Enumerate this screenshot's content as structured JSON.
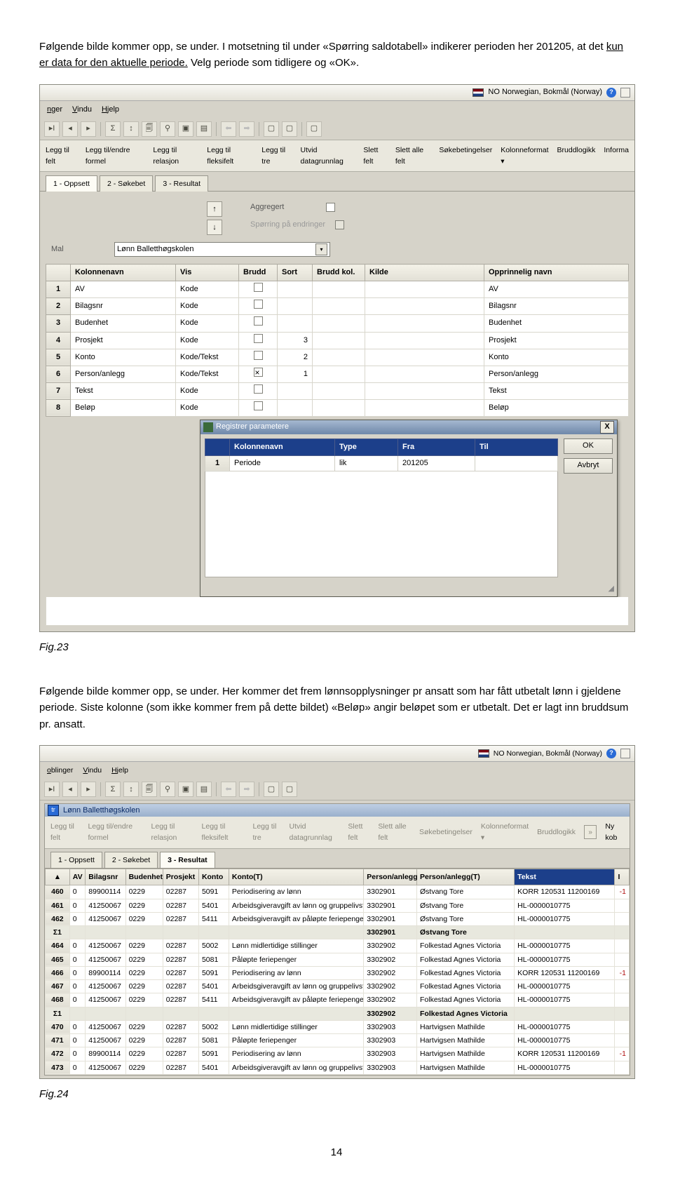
{
  "para1_a": "Følgende bilde kommer opp, se under. I motsetning til under «Spørring saldotabell» indikerer perioden her 201205, at det ",
  "para1_u": "kun er data for den aktuelle periode.",
  "para1_b": " Velg periode som tidligere og «OK».",
  "fig23": "Fig.23",
  "para2": "Følgende bilde kommer opp, se under. Her kommer det frem lønnsopplysninger pr ansatt som har fått utbetalt lønn i gjeldene periode. Siste kolonne (som ikke kommer frem på dette bildet) «Beløp» angir beløpet som er utbetalt. Det er lagt inn bruddsum pr. ansatt.",
  "fig24": "Fig.24",
  "pagenum": "14",
  "shot1": {
    "lang_label": "NO Norwegian, Bokmål (Norway)",
    "menus": {
      "nger": "nger",
      "vindu": "Vindu",
      "hjelp": "Hjelp"
    },
    "bigtoolbar": [
      "Legg til felt",
      "Legg til/endre formel",
      "Legg til relasjon",
      "Legg til fleksifelt",
      "Legg til tre",
      "Utvid datagrunnlag",
      "Slett felt",
      "Slett alle felt",
      "Søkebetingelser",
      "Kolonneformat ▾",
      "Bruddlogikk",
      "Informa"
    ],
    "tabs": [
      "1 - Oppsett",
      "2 - Søkebet",
      "3 - Resultat"
    ],
    "agg_label": "Aggregert",
    "spor_label": "Spørring på endringer",
    "mal_label": "Mal",
    "mal_value": "Lønn Balletthøgskolen",
    "grid_headers": [
      "Kolonnenavn",
      "Vis",
      "Brudd",
      "Sort",
      "Brudd kol.",
      "Kilde",
      "Opprinnelig navn"
    ],
    "rows": [
      {
        "n": "1",
        "kol": "AV",
        "vis": "Kode",
        "brudd": "",
        "sort": "",
        "bk": "",
        "on": "AV"
      },
      {
        "n": "2",
        "kol": "Bilagsnr",
        "vis": "Kode",
        "brudd": "",
        "sort": "",
        "bk": "",
        "on": "Bilagsnr"
      },
      {
        "n": "3",
        "kol": "Budenhet",
        "vis": "Kode",
        "brudd": "",
        "sort": "",
        "bk": "",
        "on": "Budenhet"
      },
      {
        "n": "4",
        "kol": "Prosjekt",
        "vis": "Kode",
        "brudd": "",
        "sort": "3",
        "bk": "",
        "on": "Prosjekt"
      },
      {
        "n": "5",
        "kol": "Konto",
        "vis": "Kode/Tekst",
        "brudd": "",
        "sort": "2",
        "bk": "",
        "on": "Konto"
      },
      {
        "n": "6",
        "kol": "Person/anlegg",
        "vis": "Kode/Tekst",
        "brudd": "X",
        "sort": "1",
        "bk": "",
        "on": "Person/anlegg"
      },
      {
        "n": "7",
        "kol": "Tekst",
        "vis": "Kode",
        "brudd": "",
        "sort": "",
        "bk": "",
        "on": "Tekst"
      },
      {
        "n": "8",
        "kol": "Beløp",
        "vis": "Kode",
        "brudd": "",
        "sort": "",
        "bk": "",
        "on": "Beløp"
      }
    ],
    "dialog_title": "Registrer parametere",
    "ptbl_headers": [
      "Kolonnenavn",
      "Type",
      "Fra",
      "Til"
    ],
    "ptbl_row": {
      "n": "1",
      "kol": "Periode",
      "type": "lik",
      "fra": "201205",
      "til": ""
    },
    "ok": "OK",
    "avbryt": "Avbryt"
  },
  "shot2": {
    "lang_label": "NO Norwegian, Bokmål (Norway)",
    "menus": {
      "oblinger": "oblinger",
      "vindu": "Vindu",
      "hjelp": "Hjelp"
    },
    "child_title": "Lønn Balletthøgskolen",
    "bigtoolbar": [
      "Legg til felt",
      "Legg til/endre formel",
      "Legg til relasjon",
      "Legg til fleksifelt",
      "Legg til tre",
      "Utvid datagrunnlag",
      "Slett felt",
      "Slett alle felt",
      "Søkebetingelser",
      "Kolonneformat ▾",
      "Bruddlogikk"
    ],
    "nykob": "Ny kob",
    "tabs": [
      "1 - Oppsett",
      "2 - Søkebet",
      "3 - Resultat"
    ],
    "headers": [
      "",
      "AV",
      "Bilagsnr",
      "Budenhet",
      "Prosjekt",
      "Konto",
      "Konto(T)",
      "Person/anlegg",
      "Person/anlegg(T)",
      "Tekst",
      "I"
    ],
    "rows": [
      {
        "n": "460",
        "av": "0",
        "bil": "89900114",
        "bud": "0229",
        "pro": "02287",
        "kon": "5091",
        "kt": "Periodisering av lønn",
        "pa": "3302901",
        "pat": "Østvang Tore",
        "t": "KORR 120531 11200169",
        "i": "-1"
      },
      {
        "n": "461",
        "av": "0",
        "bil": "41250067",
        "bud": "0229",
        "pro": "02287",
        "kon": "5401",
        "kt": "Arbeidsgiveravgift av lønn og gruppelivsf",
        "pa": "3302901",
        "pat": "Østvang Tore",
        "t": "HL-0000010775",
        "i": ""
      },
      {
        "n": "462",
        "av": "0",
        "bil": "41250067",
        "bud": "0229",
        "pro": "02287",
        "kon": "5411",
        "kt": "Arbeidsgiveravgift av påløpte feriepenger",
        "pa": "3302901",
        "pat": "Østvang Tore",
        "t": "HL-0000010775",
        "i": ""
      },
      {
        "sigma": true,
        "n": "Σ1",
        "av": "",
        "bil": "",
        "bud": "",
        "pro": "",
        "kon": "",
        "kt": "",
        "pa": "3302901",
        "pat": "Østvang Tore",
        "t": "",
        "i": ""
      },
      {
        "n": "464",
        "av": "0",
        "bil": "41250067",
        "bud": "0229",
        "pro": "02287",
        "kon": "5002",
        "kt": "Lønn midlertidige stillinger",
        "pa": "3302902",
        "pat": "Folkestad Agnes Victoria",
        "t": "HL-0000010775",
        "i": ""
      },
      {
        "n": "465",
        "av": "0",
        "bil": "41250067",
        "bud": "0229",
        "pro": "02287",
        "kon": "5081",
        "kt": "Påløpte feriepenger",
        "pa": "3302902",
        "pat": "Folkestad Agnes Victoria",
        "t": "HL-0000010775",
        "i": ""
      },
      {
        "n": "466",
        "av": "0",
        "bil": "89900114",
        "bud": "0229",
        "pro": "02287",
        "kon": "5091",
        "kt": "Periodisering av lønn",
        "pa": "3302902",
        "pat": "Folkestad Agnes Victoria",
        "t": "KORR 120531 11200169",
        "i": "-1"
      },
      {
        "n": "467",
        "av": "0",
        "bil": "41250067",
        "bud": "0229",
        "pro": "02287",
        "kon": "5401",
        "kt": "Arbeidsgiveravgift av lønn og gruppelivsf",
        "pa": "3302902",
        "pat": "Folkestad Agnes Victoria",
        "t": "HL-0000010775",
        "i": ""
      },
      {
        "n": "468",
        "av": "0",
        "bil": "41250067",
        "bud": "0229",
        "pro": "02287",
        "kon": "5411",
        "kt": "Arbeidsgiveravgift av påløpte feriepenger",
        "pa": "3302902",
        "pat": "Folkestad Agnes Victoria",
        "t": "HL-0000010775",
        "i": ""
      },
      {
        "sigma": true,
        "n": "Σ1",
        "av": "",
        "bil": "",
        "bud": "",
        "pro": "",
        "kon": "",
        "kt": "",
        "pa": "3302902",
        "pat": "Folkestad Agnes Victoria",
        "t": "",
        "i": ""
      },
      {
        "n": "470",
        "av": "0",
        "bil": "41250067",
        "bud": "0229",
        "pro": "02287",
        "kon": "5002",
        "kt": "Lønn midlertidige stillinger",
        "pa": "3302903",
        "pat": "Hartvigsen Mathilde",
        "t": "HL-0000010775",
        "i": ""
      },
      {
        "n": "471",
        "av": "0",
        "bil": "41250067",
        "bud": "0229",
        "pro": "02287",
        "kon": "5081",
        "kt": "Påløpte feriepenger",
        "pa": "3302903",
        "pat": "Hartvigsen Mathilde",
        "t": "HL-0000010775",
        "i": ""
      },
      {
        "n": "472",
        "av": "0",
        "bil": "89900114",
        "bud": "0229",
        "pro": "02287",
        "kon": "5091",
        "kt": "Periodisering av lønn",
        "pa": "3302903",
        "pat": "Hartvigsen Mathilde",
        "t": "KORR 120531 11200169",
        "i": "-1"
      },
      {
        "n": "473",
        "av": "0",
        "bil": "41250067",
        "bud": "0229",
        "pro": "02287",
        "kon": "5401",
        "kt": "Arbeidsgiveravgift av lønn og gruppelivsf",
        "pa": "3302903",
        "pat": "Hartvigsen Mathilde",
        "t": "HL-0000010775",
        "i": ""
      }
    ]
  }
}
